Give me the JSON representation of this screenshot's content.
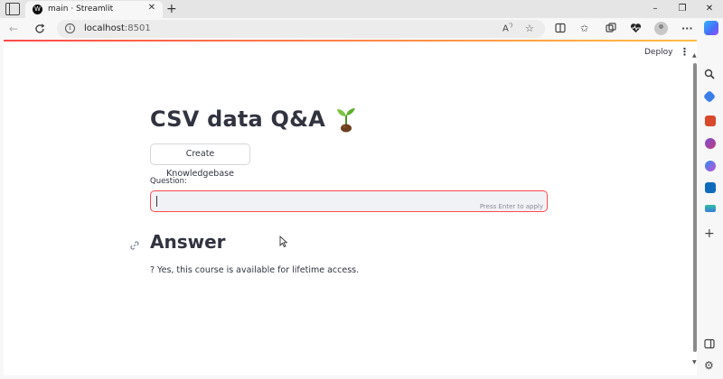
{
  "browser": {
    "tab_title": "main · Streamlit",
    "tab_favicon_letter": "W",
    "url_host": "localhost",
    "url_port": ":8501",
    "icons": {
      "tab_actions": "tab-actions-icon",
      "close_tab": "close-icon",
      "new_tab": "plus-icon",
      "back": "back-arrow-icon",
      "refresh": "refresh-icon",
      "info": "info-icon",
      "read_aloud": "read-aloud-icon",
      "favorite": "star-icon",
      "split_screen": "split-screen-icon",
      "favorites": "favorites-icon",
      "collections": "collections-icon",
      "extensions": "heart-pulse-icon",
      "profile": "profile-avatar-icon",
      "more": "more-icon",
      "copilot": "copilot-icon"
    },
    "window_buttons": [
      "–",
      "❐",
      "✕"
    ]
  },
  "app": {
    "deploy_label": "Deploy",
    "menu_glyph": "⋮",
    "title": "CSV data Q&A",
    "title_emoji": "sprout-icon",
    "kb_button_label": "Create Knowledgebase",
    "question_label": "Question:",
    "question_value": "",
    "enter_hint": "Press Enter to apply",
    "answer_heading": "Answer",
    "answer_text": "? Yes, this course is available for lifetime access."
  },
  "colors": {
    "accent": "#ff4b4b",
    "text": "#31333f",
    "input_bg": "#f0f2f6",
    "deco_gradient_end": "#ffbd45"
  },
  "edge_sidebar": {
    "items": [
      "search-icon",
      "shopping-tag-icon",
      "toolbox-icon",
      "games-icon",
      "microsoft-365-icon",
      "outlook-icon",
      "designer-icon",
      "add-icon",
      "sidebar-toggle-icon",
      "settings-icon"
    ]
  }
}
